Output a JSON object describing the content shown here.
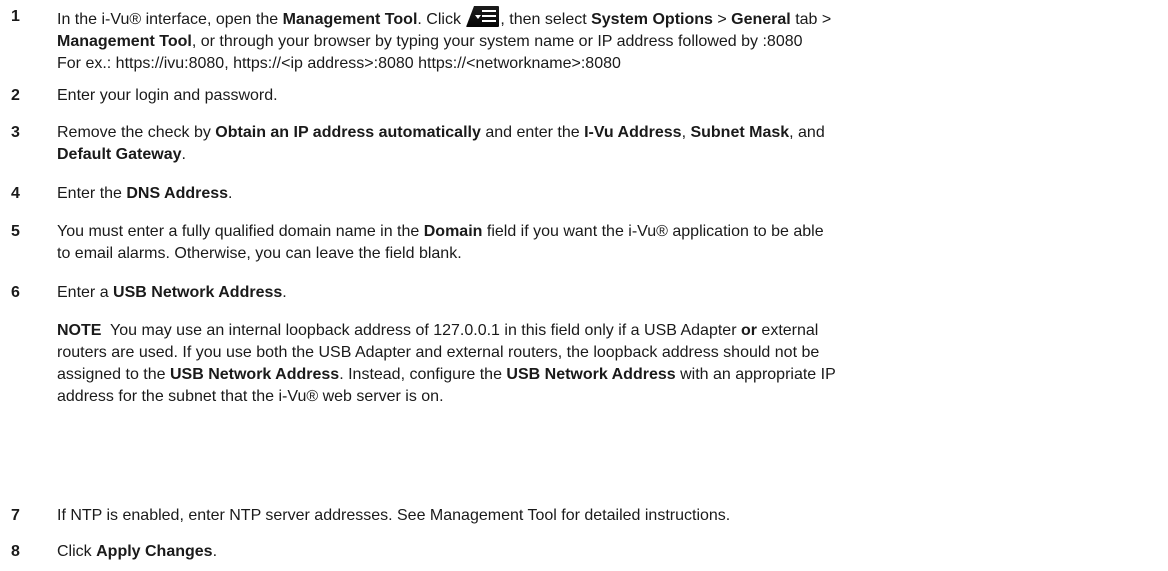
{
  "steps": [
    {
      "number": "1",
      "line1": {
        "t1": "In the i-Vu® interface, open the ",
        "b1": "Management Tool",
        "t2": ". Click ",
        "t3": ", then select ",
        "b2": "System Options",
        "t4": " > ",
        "b3": "General",
        "t5": " tab >"
      },
      "line2": {
        "b1": "Management Tool",
        "t1": ", or through your browser by typing your system name or IP address followed by :8080"
      },
      "line3": "For ex.: https://ivu:8080,  https://<ip address>:8080 https://<networkname>:8080"
    },
    {
      "number": "2",
      "text": "Enter your login and password."
    },
    {
      "number": "3",
      "t1": "Remove the check by ",
      "b1": "Obtain an IP address automatically",
      "t2": " and enter the ",
      "b2": "I-Vu Address",
      "t3": ", ",
      "b3": "Subnet Mask",
      "t4": ", and",
      "b4": "Default Gateway",
      "t5": "."
    },
    {
      "number": "4",
      "t1": "Enter the ",
      "b1": "DNS Address",
      "t2": "."
    },
    {
      "number": "5",
      "t1": "You must enter a fully qualified domain name in the ",
      "b1": "Domain",
      "t2": " field if you want the i-Vu® application to be able",
      "t3": "to email alarms. Otherwise, you can leave the field blank."
    },
    {
      "number": "6",
      "t1": "Enter a ",
      "b1": "USB Network Address",
      "t2": "."
    },
    {
      "number": "7",
      "text": "If NTP is enabled, enter NTP server addresses. See Management Tool for detailed instructions."
    },
    {
      "number": "8",
      "t1": "Click ",
      "b1": "Apply Changes",
      "t2": "."
    }
  ],
  "note": {
    "label": "NOTE",
    "t1": "  You may use an internal loopback address of 127.0.0.1 in this field only if a USB Adapter ",
    "b1": "or",
    "t2": " external",
    "t3": "routers are used. If you use both the USB Adapter and external routers, the loopback address should not be",
    "t4": "assigned to the ",
    "b2": "USB Network Address",
    "t5": ". Instead, configure the ",
    "b3": "USB Network Address",
    "t6": " with an appropriate IP",
    "t7": "address for the subnet that the i-Vu® web server is on."
  },
  "icons": {
    "toolbar_icon": "menu-dropdown-icon"
  }
}
